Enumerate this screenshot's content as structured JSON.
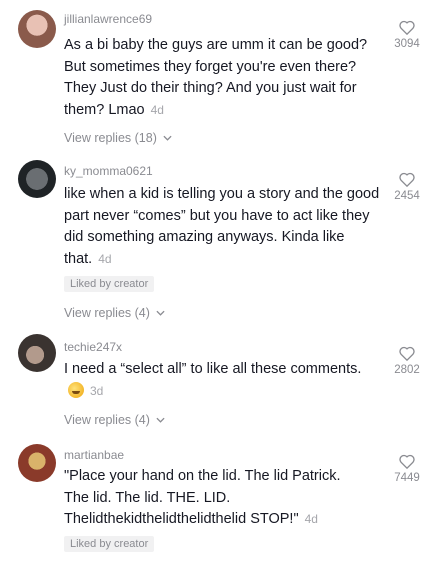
{
  "comments": [
    {
      "username": "jillianlawrence69",
      "text": "As a bi baby the guys are umm it can be good? But sometimes they forget you're even there? They Just do their thing? And you just wait for them? Lmao",
      "time": "4d",
      "likes": "3094",
      "replies_label": "View replies (18)",
      "avatar_colors": [
        "#d9a79b",
        "#8a5a4b"
      ]
    },
    {
      "username": "ky_momma0621",
      "text": "like when a kid is telling you a story and the good part never “comes” but you have to act like they did something amazing anyways. Kinda like that.",
      "time": "4d",
      "likes": "2454",
      "liked_badge": "Liked by creator",
      "replies_label": "View replies (4)",
      "avatar_colors": [
        "#5b5f62",
        "#1f2326"
      ]
    },
    {
      "username": "techie247x",
      "text": "I need a “select all” to like all these comments.",
      "time": "3d",
      "likes": "2802",
      "replies_label": "View replies (4)",
      "avatar_colors": [
        "#3a3330",
        "#b29a8c"
      ]
    },
    {
      "username": "martianbae",
      "text": "\"Place your hand on the lid. The lid Patrick. The lid. The lid. THE. LID. Thelidthekidthelidthelidthelid STOP!\"",
      "time": "4d",
      "likes": "7449",
      "liked_badge": "Liked by creator",
      "avatar_colors": [
        "#8a3a2a",
        "#d9b36a"
      ]
    }
  ]
}
